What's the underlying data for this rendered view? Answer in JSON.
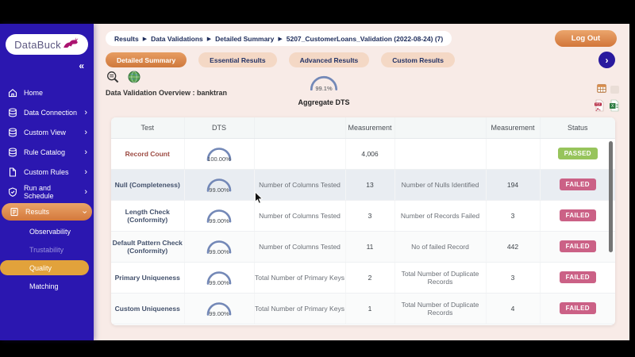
{
  "app": {
    "logo_text": "DataBuck",
    "logout_label": "Log Out",
    "collapse_icon": "«",
    "next_tabs_icon": "›"
  },
  "colors": {
    "sidebar_purple": "#2b17b0",
    "accent_orange": "#d67b3e",
    "quality_orange": "#e2a23b",
    "passed_green": "#97c45c",
    "failed_pink": "#cb6186",
    "gauge_blue": "#7388b7"
  },
  "sidebar": {
    "items": [
      {
        "label": "Home",
        "icon": "home-icon",
        "chevron": ""
      },
      {
        "label": "Data Connection",
        "icon": "database-icon",
        "chevron": "›"
      },
      {
        "label": "Custom View",
        "icon": "database-icon",
        "chevron": "›"
      },
      {
        "label": "Rule Catalog",
        "icon": "database-icon",
        "chevron": "›"
      },
      {
        "label": "Custom Rules",
        "icon": "file-icon",
        "chevron": "›"
      },
      {
        "label": "Run and Schedule",
        "icon": "shield-icon",
        "chevron": "›"
      },
      {
        "label": "Results",
        "icon": "clipboard-icon",
        "chevron": "›"
      }
    ],
    "sub_items": [
      {
        "label": "Observability"
      },
      {
        "label": "Trustability"
      },
      {
        "label": "Quality"
      },
      {
        "label": "Matching"
      }
    ]
  },
  "breadcrumb": {
    "separator": "▶",
    "parts": [
      "Results",
      "Data Validations",
      "Detailed Summary",
      "5207_CustomerLoans_Validation (2022-08-24) (7)"
    ]
  },
  "tabs": [
    {
      "label": "Detailed Summary"
    },
    {
      "label": "Essential Results"
    },
    {
      "label": "Advanced Results"
    },
    {
      "label": "Custom Results"
    }
  ],
  "overview": {
    "title": "Data Validation Overview : banktran",
    "aggregate": {
      "value": "99.1%",
      "label": "Aggregate DTS",
      "percent": 99.1
    }
  },
  "table": {
    "headers": [
      "Test",
      "DTS",
      "",
      "Measurement",
      "",
      "Measurement",
      "Status"
    ],
    "rows": [
      {
        "test": "Record Count",
        "dts": "100.00%",
        "dts_percent": 100,
        "m1_label": "",
        "m1_value": "4,006",
        "m2_label": "",
        "m2_value": "",
        "status": "PASSED"
      },
      {
        "test": "Null (Completeness)",
        "dts": "99.00%",
        "dts_percent": 99,
        "m1_label": "Number of Columns Tested",
        "m1_value": "13",
        "m2_label": "Number of Nulls Identified",
        "m2_value": "194",
        "status": "FAILED"
      },
      {
        "test": "Length Check (Conformity)",
        "dts": "99.00%",
        "dts_percent": 99,
        "m1_label": "Number of Columns Tested",
        "m1_value": "3",
        "m2_label": "Number of Records Failed",
        "m2_value": "3",
        "status": "FAILED"
      },
      {
        "test": "Default Pattern Check (Conformity)",
        "dts": "99.00%",
        "dts_percent": 99,
        "m1_label": "Number of Columns Tested",
        "m1_value": "11",
        "m2_label": "No of failed Record",
        "m2_value": "442",
        "status": "FAILED"
      },
      {
        "test": "Primary Uniqueness",
        "dts": "99.00%",
        "dts_percent": 99,
        "m1_label": "Total Number of Primary Keys",
        "m1_value": "2",
        "m2_label": "Total Number of Duplicate Records",
        "m2_value": "3",
        "status": "FAILED"
      },
      {
        "test": "Custom Uniqueness",
        "dts": "99.00%",
        "dts_percent": 99,
        "m1_label": "Total Number of Primary Keys",
        "m1_value": "1",
        "m2_label": "Total Number of Duplicate Records",
        "m2_value": "4",
        "status": "FAILED"
      }
    ]
  }
}
